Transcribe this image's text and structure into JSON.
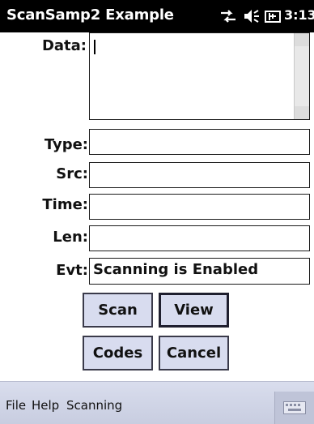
{
  "window": {
    "title": "ScanSamp2 Example",
    "clock": "3:13"
  },
  "status_icons": [
    "connectivity-icon",
    "speaker-icon",
    "battery-icon"
  ],
  "form": {
    "data_label": "Data:",
    "data_value": "",
    "type_label": "Type:",
    "type_value": "",
    "src_label": "Src:",
    "src_value": "",
    "time_label": "Time:",
    "time_value": "",
    "len_label": "Len:",
    "len_value": "",
    "evt_label": "Evt:",
    "evt_value": "Scanning is Enabled"
  },
  "buttons": {
    "scan": "Scan",
    "view": "View",
    "codes": "Codes",
    "cancel": "Cancel"
  },
  "menu": {
    "file": "File",
    "help": "Help",
    "scanning": "Scanning"
  },
  "colors": {
    "titlebar": "#000000",
    "button_bg": "#d8dcef",
    "menubar": "#c8cde0"
  }
}
